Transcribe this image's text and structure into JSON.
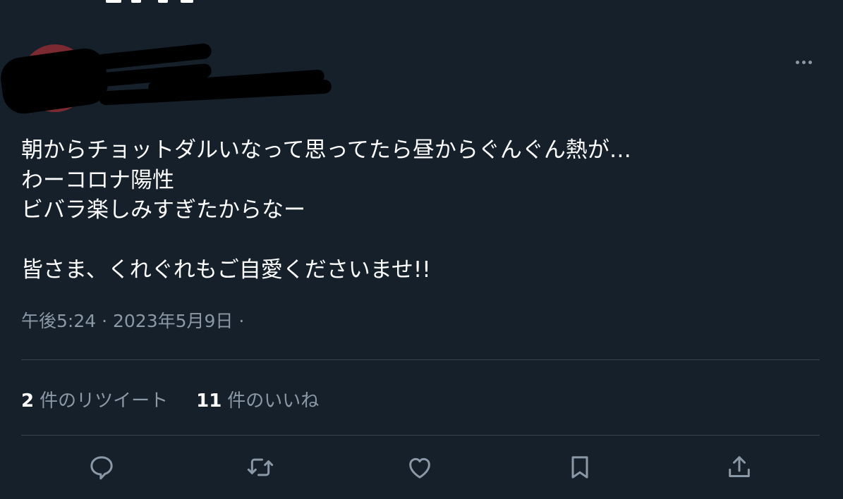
{
  "tweet": {
    "author": {
      "name": "",
      "handle": ""
    },
    "text": "朝からチョットダルいなって思ってたら昼からぐんぐん熱が…\nわーコロナ陽性\nビバラ楽しみすぎたからなー\n\n皆さま、くれぐれもご自愛くださいませ!!",
    "time": "午後5:24",
    "date": "2023年5月9日",
    "separator": "·"
  },
  "stats": {
    "retweets_count": "2",
    "retweets_label": "件のリツイート",
    "likes_count": "11",
    "likes_label": "件のいいね"
  },
  "icons": {
    "more": "more-horizontal-icon",
    "reply": "reply-icon",
    "retweet": "retweet-icon",
    "like": "like-icon",
    "bookmark": "bookmark-icon",
    "share": "share-icon"
  },
  "colors": {
    "background": "#15202b",
    "text": "#ffffff",
    "secondary_text": "#8b98a5",
    "divider": "#38444d"
  }
}
